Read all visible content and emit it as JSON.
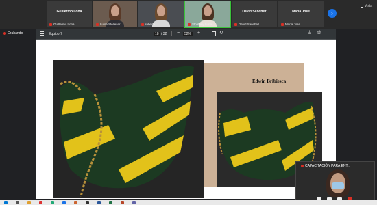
{
  "participants": [
    {
      "name": "Guillermo Lona",
      "label": "Guillermo Lona",
      "video": false
    },
    {
      "name": "",
      "label": "Luisa Stelleser",
      "video": true
    },
    {
      "name": "",
      "label": "rebeca",
      "video": true
    },
    {
      "name": "",
      "label": "Sthefany Luna",
      "video": true,
      "speaking": true
    },
    {
      "name": "David Sánchez",
      "label": "David Sánchez",
      "video": false
    },
    {
      "name": "Maria Jose",
      "label": "Maria Jose",
      "video": false
    }
  ],
  "view_label": "Vista",
  "recording_label": "Grabando",
  "viewer": {
    "title": "Equipo 7",
    "page_current": "18",
    "page_total": "/ 32",
    "zoom": "52%"
  },
  "slide": {
    "designer_name": "Edwin Bribiesca"
  },
  "pip": {
    "label": "CAPACITACIÓN PARA ENT..."
  },
  "colors": {
    "accent_blue": "#1a73e8",
    "record_red": "#d93025",
    "bag_green": "#1f5a2a",
    "bag_yellow": "#e2c21a",
    "beige": "#ccb196"
  },
  "icons": {
    "menu": "hamburger-icon",
    "download": "download-icon",
    "print": "print-icon",
    "more": "more-vertical-icon",
    "next": "chevron-right-icon"
  }
}
